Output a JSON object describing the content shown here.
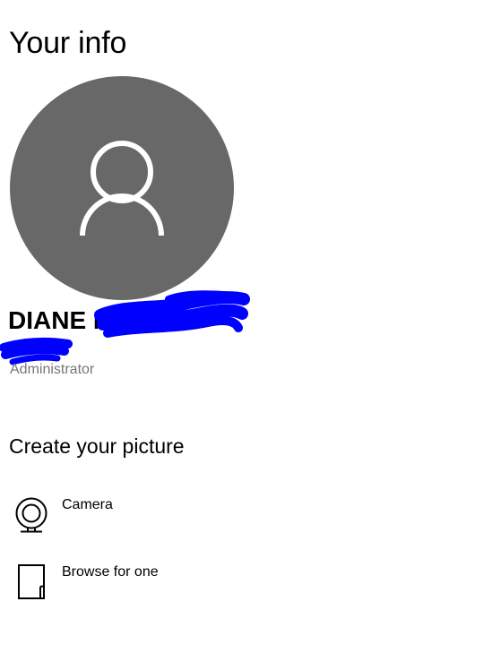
{
  "page": {
    "title": "Your info"
  },
  "user": {
    "name": "DIANE M",
    "account_type": "Administrator",
    "avatar_icon": "person-icon"
  },
  "create_picture": {
    "title": "Create your picture",
    "options": [
      {
        "label": "Camera",
        "icon": "webcam-icon"
      },
      {
        "label": "Browse for one",
        "icon": "document-icon"
      }
    ]
  },
  "colors": {
    "avatar_background": "#686868",
    "redaction_scribble": "#0000ff",
    "secondary_text": "#767676"
  }
}
